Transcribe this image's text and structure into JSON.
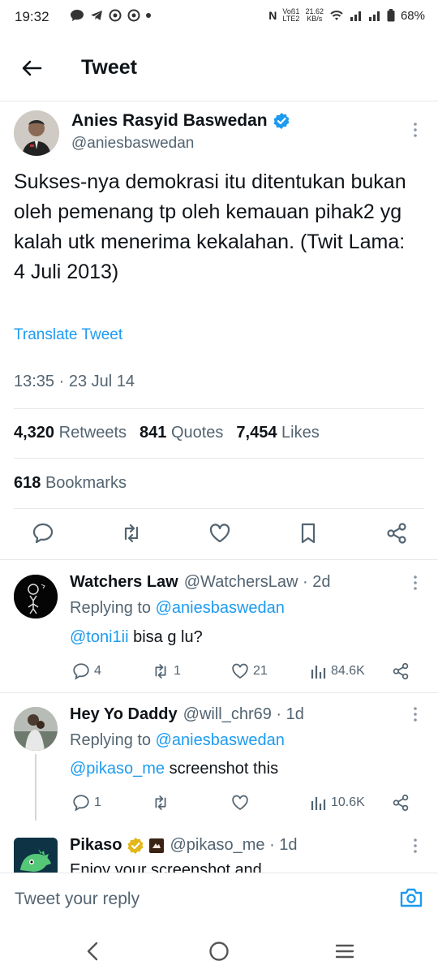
{
  "status_bar": {
    "time": "19:32",
    "net_top": "Voß1",
    "net_bottom": "LTE2",
    "speed_top": "21.62",
    "speed_bottom": "KB/s",
    "battery": "68%"
  },
  "header": {
    "title": "Tweet"
  },
  "main_tweet": {
    "author_name": "Anies Rasyid Baswedan",
    "author_handle": "@aniesbaswedan",
    "text": "Sukses-nya demokrasi itu ditentukan bukan oleh pemenang tp oleh kemauan pihak2 yg kalah utk menerima kekalahan. (Twit Lama: 4 Juli 2013)",
    "translate_label": "Translate Tweet",
    "timestamp": "13:35 · 23 Jul 14",
    "retweets_count": "4,320",
    "retweets_label": "Retweets",
    "quotes_count": "841",
    "quotes_label": "Quotes",
    "likes_count": "7,454",
    "likes_label": "Likes",
    "bookmarks_count": "618",
    "bookmarks_label": "Bookmarks"
  },
  "replies": [
    {
      "name": "Watchers Law",
      "handle": "@WatchersLaw · 2d",
      "replying_prefix": "Replying to",
      "replying_to": "@aniesbaswedan",
      "mention": "@toni1ii",
      "text": " bisa g lu?",
      "reply_count": "4",
      "retweet_count": "1",
      "like_count": "21",
      "views": "84.6K"
    },
    {
      "name": "Hey Yo Daddy",
      "handle": "@will_chr69 · 1d",
      "replying_prefix": "Replying to",
      "replying_to": "@aniesbaswedan",
      "mention": "@pikaso_me",
      "text": " screenshot this",
      "reply_count": "1",
      "views": "10.6K"
    },
    {
      "name": "Pikaso",
      "handle": "@pikaso_me · 1d",
      "text_partial": "Enjoy your screenshot and"
    }
  ],
  "reply_bar": {
    "placeholder": "Tweet your reply"
  },
  "colors": {
    "accent": "#1d9bf0",
    "text": "#0f1419",
    "muted": "#536471",
    "verified_gold": "#e2b719"
  }
}
